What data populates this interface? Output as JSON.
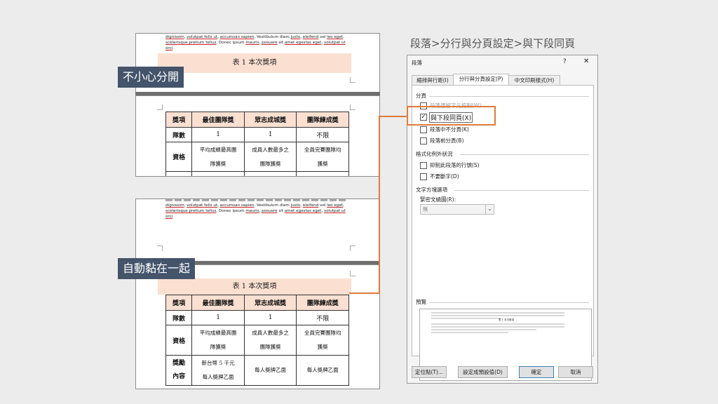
{
  "slide_title": "段落>分行與分頁設定>與下段同頁",
  "labels": {
    "split": "不小心分開",
    "together": "自動黏在一起"
  },
  "doc": {
    "lorem_lines": [
      [
        "dignissim",
        ", ",
        "volutpat felis ut",
        ", ",
        "accumsan sapien",
        ". Vestibulum diam ",
        "justo",
        ", ",
        "eleifend",
        " vel ",
        "leo eget",
        ","
      ],
      [
        "scelerisque pretium tellus",
        ". Donec ipsum ",
        "mauris",
        ", ",
        "posuere",
        " sit ",
        "amet egestas eget",
        ", ",
        "volutpat ut"
      ],
      [
        "orci",
        "."
      ]
    ],
    "caption": "表 1  本次獎項",
    "table": {
      "headers": [
        "獎項",
        "最佳團隊獎",
        "眾志成城獎",
        "團隊練成獎"
      ],
      "rows": [
        {
          "label": "隊數",
          "cells": [
            "1",
            "1",
            "不限"
          ]
        },
        {
          "label": "資格",
          "cells": [
            "平均成績最高團隊獲獎",
            "成員人數最多之團隊獲獎",
            "全員完賽團隊均獲獎"
          ]
        },
        {
          "label": "獎勵內容",
          "cells": [
            "新台幣 5 千元每人獎牌乙面",
            "每人獎牌乙面",
            "每人獎牌乙面"
          ]
        }
      ]
    },
    "table_lines": {
      "qual": [
        [
          "平均成績最高團",
          "隊獲獎"
        ],
        [
          "成員人數最多之",
          "團隊獲獎"
        ],
        [
          "全員完賽團隊均",
          "獲獎"
        ]
      ],
      "reward_label": [
        "獎勵",
        "內容"
      ],
      "reward_c1": [
        "新台幣 5 千元",
        "每人獎牌乙面"
      ]
    }
  },
  "dialog": {
    "title": "段落",
    "help": "?",
    "close": "✕",
    "tabs": [
      "縮排與行距(I)",
      "分行與分頁設定(P)",
      "中文印刷樣式(H)"
    ],
    "pagination_header": "分頁",
    "options": [
      {
        "label": "段落遺留字元控制(W)",
        "checked": false
      },
      {
        "label": "與下段同頁(X)",
        "checked": true
      },
      {
        "label": "段落中不分頁(K)",
        "checked": false
      },
      {
        "label": "段落前分頁(B)",
        "checked": false
      }
    ],
    "exceptions_header": "格式化例外狀況",
    "exceptions": [
      {
        "label": "抑制此段落的行號(S)",
        "checked": false
      },
      {
        "label": "不要斷字(D)",
        "checked": false
      }
    ],
    "textbox_header": "文字方塊選項",
    "wrap_label": "緊密文繞圖(R):",
    "wrap_value": "無",
    "preview_header": "預覽",
    "preview_title": "表 1 本次獎項",
    "buttons": {
      "tabs": "定位點(T)...",
      "default": "設定成預設值(D)",
      "ok": "確定",
      "cancel": "取消"
    }
  },
  "colors": {
    "label_bg": "#44546a",
    "highlight": "#e07b39",
    "caption_bg": "#fbe0d2",
    "primary_border": "#3c7fb1"
  }
}
